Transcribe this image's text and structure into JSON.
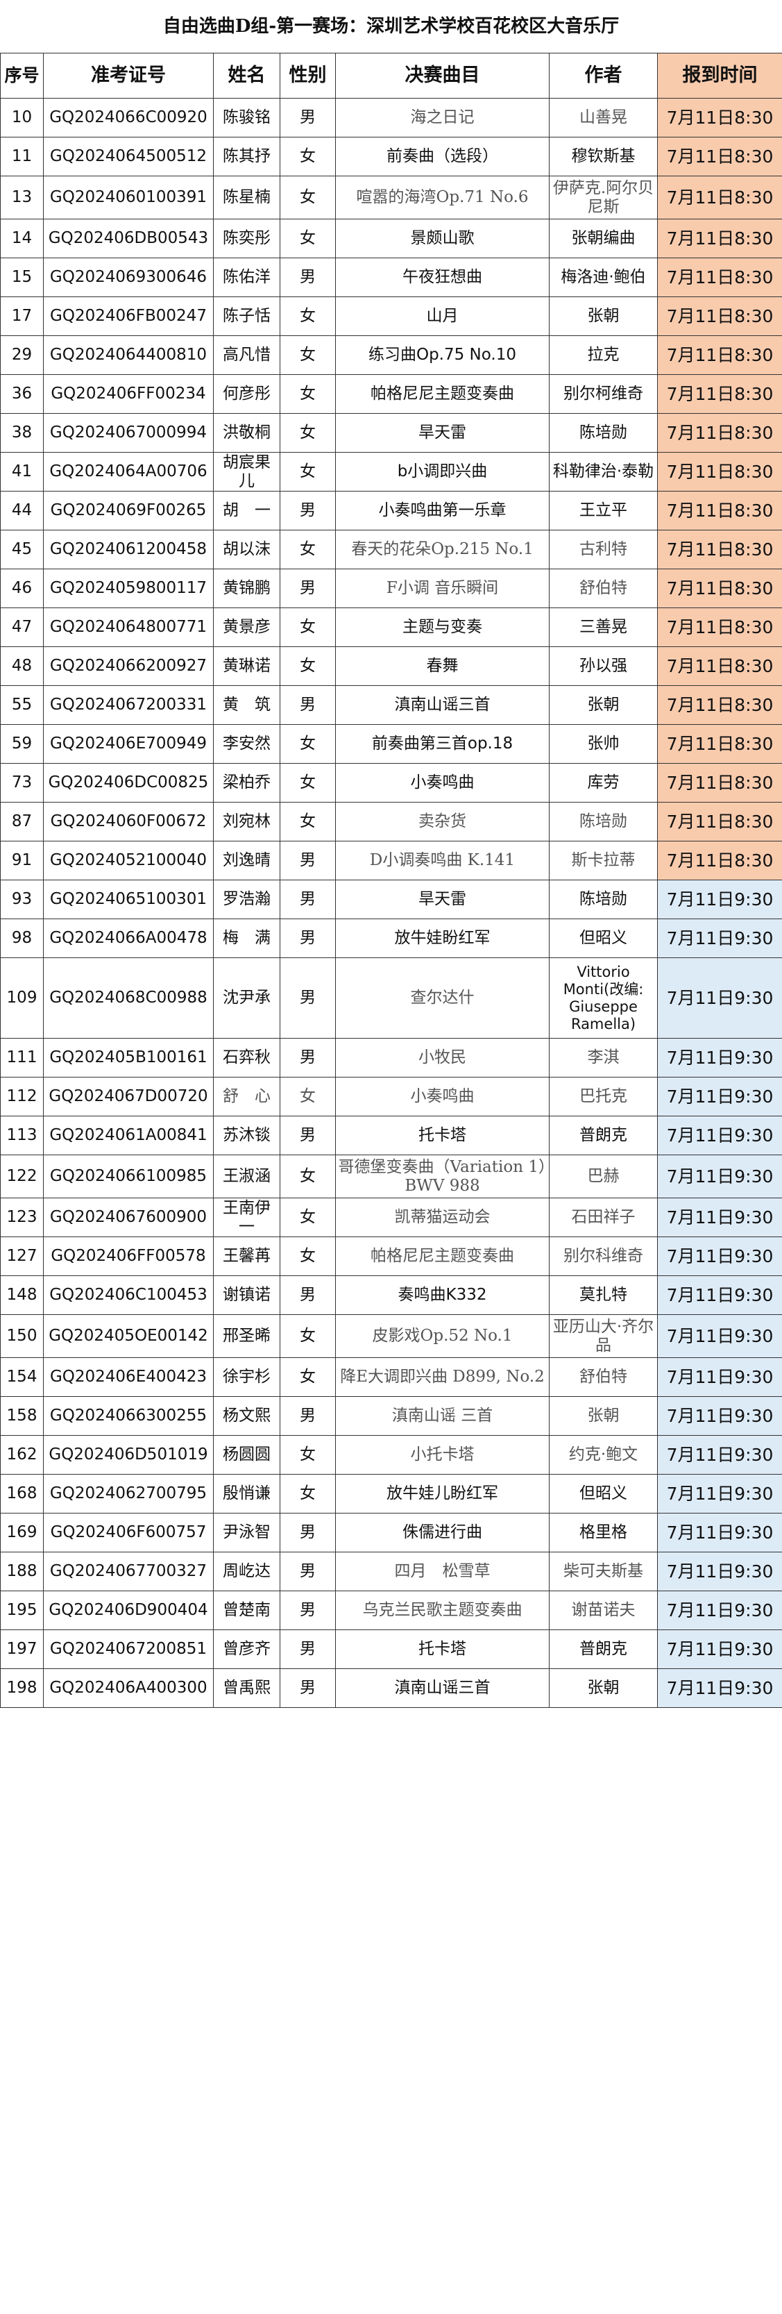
{
  "title": "自由选曲D组-第一赛场：深圳艺术学校百花校区大音乐厅",
  "headers": {
    "seq": "序号",
    "exam_no": "准考证号",
    "name": "姓名",
    "gender": "性别",
    "piece": "决赛曲目",
    "composer": "作者",
    "time": "报到时间"
  },
  "colors": {
    "morning_fill": "#f8cbad",
    "later_fill": "#ddebf7",
    "grid": "#333333"
  },
  "rows": [
    {
      "seq": "10",
      "exam_no": "GQ2024066C00920",
      "name": "陈骏铭",
      "gender": "男",
      "piece": "海之日记",
      "composer": "山善晃",
      "time": "7月11日8:30"
    },
    {
      "seq": "11",
      "exam_no": "GQ2024064500512",
      "name": "陈其抒",
      "gender": "女",
      "piece": "前奏曲（选段）",
      "composer": "穆钦斯基",
      "time": "7月11日8:30"
    },
    {
      "seq": "13",
      "exam_no": "GQ2024060100391",
      "name": "陈星楠",
      "gender": "女",
      "piece": "喧嚣的海湾Op.71 No.6",
      "composer": "伊萨克.阿尔贝尼斯",
      "time": "7月11日8:30"
    },
    {
      "seq": "14",
      "exam_no": "GQ202406DB00543",
      "name": "陈奕彤",
      "gender": "女",
      "piece": "景颇山歌",
      "composer": "张朝编曲",
      "time": "7月11日8:30"
    },
    {
      "seq": "15",
      "exam_no": "GQ2024069300646",
      "name": "陈佑洋",
      "gender": "男",
      "piece": "午夜狂想曲",
      "composer": "梅洛迪·鲍伯",
      "time": "7月11日8:30"
    },
    {
      "seq": "17",
      "exam_no": "GQ202406FB00247",
      "name": "陈子恬",
      "gender": "女",
      "piece": "山月",
      "composer": "张朝",
      "time": "7月11日8:30"
    },
    {
      "seq": "29",
      "exam_no": "GQ2024064400810",
      "name": "高凡惜",
      "gender": "女",
      "piece": "练习曲Op.75 No.10",
      "composer": "拉克",
      "time": "7月11日8:30"
    },
    {
      "seq": "36",
      "exam_no": "GQ202406FF00234",
      "name": "何彦彤",
      "gender": "女",
      "piece": "帕格尼尼主题变奏曲",
      "composer": "别尔柯维奇",
      "time": "7月11日8:30"
    },
    {
      "seq": "38",
      "exam_no": "GQ2024067000994",
      "name": "洪敬桐",
      "gender": "女",
      "piece": "旱天雷",
      "composer": "陈培勋",
      "time": "7月11日8:30"
    },
    {
      "seq": "41",
      "exam_no": "GQ2024064A00706",
      "name": "胡宸果儿",
      "gender": "女",
      "piece": "b小调即兴曲",
      "composer": "科勒律治·泰勒",
      "time": "7月11日8:30"
    },
    {
      "seq": "44",
      "exam_no": "GQ2024069F00265",
      "name": "胡　一",
      "gender": "男",
      "piece": "小奏鸣曲第一乐章",
      "composer": "王立平",
      "time": "7月11日8:30"
    },
    {
      "seq": "45",
      "exam_no": "GQ2024061200458",
      "name": "胡以沫",
      "gender": "女",
      "piece": "春天的花朵Op.215 No.1",
      "composer": "古利特",
      "time": "7月11日8:30"
    },
    {
      "seq": "46",
      "exam_no": "GQ2024059800117",
      "name": "黄锦鹏",
      "gender": "男",
      "piece": "F小调 音乐瞬间",
      "composer": "舒伯特",
      "time": "7月11日8:30"
    },
    {
      "seq": "47",
      "exam_no": "GQ2024064800771",
      "name": "黄景彦",
      "gender": "女",
      "piece": "主题与变奏",
      "composer": "三善晃",
      "time": "7月11日8:30"
    },
    {
      "seq": "48",
      "exam_no": "GQ2024066200927",
      "name": "黄琳诺",
      "gender": "女",
      "piece": "春舞",
      "composer": "孙以强",
      "time": "7月11日8:30"
    },
    {
      "seq": "55",
      "exam_no": "GQ2024067200331",
      "name": "黄　筑",
      "gender": "男",
      "piece": "滇南山谣三首",
      "composer": "张朝",
      "time": "7月11日8:30"
    },
    {
      "seq": "59",
      "exam_no": "GQ202406E700949",
      "name": "李安然",
      "gender": "女",
      "piece": "前奏曲第三首op.18",
      "composer": "张帅",
      "time": "7月11日8:30"
    },
    {
      "seq": "73",
      "exam_no": "GQ202406DC00825",
      "name": "梁柏乔",
      "gender": "女",
      "piece": "小奏鸣曲",
      "composer": "库劳",
      "time": "7月11日8:30"
    },
    {
      "seq": "87",
      "exam_no": "GQ2024060F00672",
      "name": "刘宛林",
      "gender": "女",
      "piece": "卖杂货",
      "composer": "陈培勋",
      "time": "7月11日8:30"
    },
    {
      "seq": "91",
      "exam_no": "GQ2024052100040",
      "name": "刘逸晴",
      "gender": "男",
      "piece": "D小调奏鸣曲 K.141",
      "composer": "斯卡拉蒂",
      "time": "7月11日8:30"
    },
    {
      "seq": "93",
      "exam_no": "GQ2024065100301",
      "name": "罗浩瀚",
      "gender": "男",
      "piece": "旱天雷",
      "composer": "陈培勋",
      "time": "7月11日9:30"
    },
    {
      "seq": "98",
      "exam_no": "GQ2024066A00478",
      "name": "梅　满",
      "gender": "男",
      "piece": "放牛娃盼红军",
      "composer": "但昭义",
      "time": "7月11日9:30"
    },
    {
      "seq": "109",
      "exam_no": "GQ2024068C00988",
      "name": "沈尹承",
      "gender": "男",
      "piece": "查尔达什",
      "composer": "Vittorio Monti(改编: Giuseppe Ramella)",
      "time": "7月11日9:30"
    },
    {
      "seq": "111",
      "exam_no": "GQ202405B100161",
      "name": "石弈秋",
      "gender": "男",
      "piece": "小牧民",
      "composer": "李淇",
      "time": "7月11日9:30"
    },
    {
      "seq": "112",
      "exam_no": "GQ2024067D00720",
      "name": "舒　心",
      "gender": "女",
      "piece": "小奏鸣曲",
      "composer": "巴托克",
      "time": "7月11日9:30"
    },
    {
      "seq": "113",
      "exam_no": "GQ2024061A00841",
      "name": "苏沐锬",
      "gender": "男",
      "piece": "托卡塔",
      "composer": "普朗克",
      "time": "7月11日9:30"
    },
    {
      "seq": "122",
      "exam_no": "GQ2024066100985",
      "name": "王淑涵",
      "gender": "女",
      "piece": "哥德堡变奏曲（Variation 1）BWV 988",
      "composer": "巴赫",
      "time": "7月11日9:30"
    },
    {
      "seq": "123",
      "exam_no": "GQ2024067600900",
      "name": "王南伊一",
      "gender": "女",
      "piece": "凯蒂猫运动会",
      "composer": "石田祥子",
      "time": "7月11日9:30"
    },
    {
      "seq": "127",
      "exam_no": "GQ202406FF00578",
      "name": "王馨苒",
      "gender": "女",
      "piece": "帕格尼尼主题变奏曲",
      "composer": "别尔科维奇",
      "time": "7月11日9:30"
    },
    {
      "seq": "148",
      "exam_no": "GQ202406C100453",
      "name": "谢镇诺",
      "gender": "男",
      "piece": "奏鸣曲K332",
      "composer": "莫扎特",
      "time": "7月11日9:30"
    },
    {
      "seq": "150",
      "exam_no": "GQ202405OE00142",
      "name": "邢圣晞",
      "gender": "女",
      "piece": "皮影戏Op.52 No.1",
      "composer": "亚历山大·齐尔品",
      "time": "7月11日9:30"
    },
    {
      "seq": "154",
      "exam_no": "GQ202406E400423",
      "name": "徐宇杉",
      "gender": "女",
      "piece": "降E大调即兴曲 D899, No.2",
      "composer": "舒伯特",
      "time": "7月11日9:30"
    },
    {
      "seq": "158",
      "exam_no": "GQ2024066300255",
      "name": "杨文熙",
      "gender": "男",
      "piece": "滇南山谣 三首",
      "composer": "张朝",
      "time": "7月11日9:30"
    },
    {
      "seq": "162",
      "exam_no": "GQ202406D501019",
      "name": "杨圆圆",
      "gender": "女",
      "piece": "小托卡塔",
      "composer": "约克·鲍文",
      "time": "7月11日9:30"
    },
    {
      "seq": "168",
      "exam_no": "GQ2024062700795",
      "name": "殷悄谦",
      "gender": "女",
      "piece": "放牛娃儿盼红军",
      "composer": "但昭义",
      "time": "7月11日9:30"
    },
    {
      "seq": "169",
      "exam_no": "GQ202406F600757",
      "name": "尹泳智",
      "gender": "男",
      "piece": "侏儒进行曲",
      "composer": "格里格",
      "time": "7月11日9:30"
    },
    {
      "seq": "188",
      "exam_no": "GQ2024067700327",
      "name": "周屹达",
      "gender": "男",
      "piece": "四月　松雪草",
      "composer": "柴可夫斯基",
      "time": "7月11日9:30"
    },
    {
      "seq": "195",
      "exam_no": "GQ202406D900404",
      "name": "曾楚南",
      "gender": "男",
      "piece": "乌克兰民歌主题变奏曲",
      "composer": "谢苗诺夫",
      "time": "7月11日9:30"
    },
    {
      "seq": "197",
      "exam_no": "GQ2024067200851",
      "name": "曾彦齐",
      "gender": "男",
      "piece": "托卡塔",
      "composer": "普朗克",
      "time": "7月11日9:30"
    },
    {
      "seq": "198",
      "exam_no": "GQ202406A400300",
      "name": "曾禹熙",
      "gender": "男",
      "piece": "滇南山谣三首",
      "composer": "张朝",
      "time": "7月11日9:30"
    }
  ]
}
